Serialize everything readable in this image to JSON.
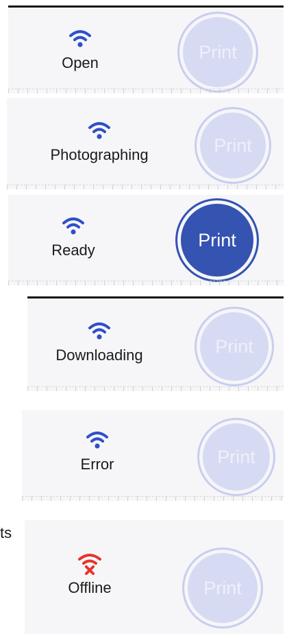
{
  "print_label": "Print",
  "edge_fragment": "ts",
  "colors": {
    "wifi_blue": "#2f4fc9",
    "wifi_red": "#e8332a",
    "active_button": "#3553b0",
    "inactive_button": "#d7daf3"
  },
  "icons": {
    "wifi": "wifi-icon",
    "wifi_off": "wifi-error-icon"
  },
  "rows": [
    {
      "label": "Open",
      "state": "disabled"
    },
    {
      "label": "Photographing",
      "state": "disabled"
    },
    {
      "label": "Ready",
      "state": "enabled"
    },
    {
      "label": "Downloading",
      "state": "disabled"
    },
    {
      "label": "Error",
      "state": "disabled"
    },
    {
      "label": "Offline",
      "state": "disabled"
    }
  ]
}
